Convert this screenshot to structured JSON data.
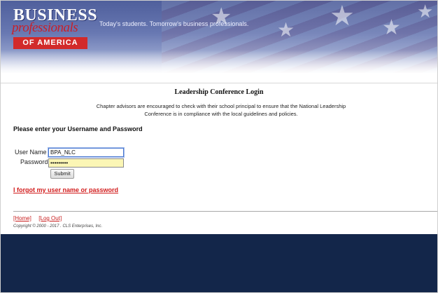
{
  "banner": {
    "logo_line1": "BUSINESS",
    "logo_line2": "professionals",
    "logo_line3": "OF AMERICA",
    "tagline": "Today's students. Tomorrow's business professionals."
  },
  "page": {
    "title": "Leadership Conference Login",
    "notice": "Chapter advisors are encouraged to check with their school principal to ensure that the National Leadership Conference is in compliance with the local guidelines and policies.",
    "prompt": "Please enter your Username and Password"
  },
  "form": {
    "username_label": "User Name",
    "username_value": "BPA_NLC",
    "password_label": "Password",
    "password_value": "•••••••••",
    "submit_label": "Submit",
    "forgot_link": "I forgot my user name or password"
  },
  "footer": {
    "home_link": "[Home]",
    "logout_link": "[Log Out]",
    "copyright": "Copyright © 2000 - 2017 . CLS Enterprises, Inc."
  },
  "colors": {
    "banner_blue": "#4f5f9c",
    "link_red": "#d21d1d",
    "bottom_navy": "#13264a",
    "password_fill": "#fbf6b5"
  },
  "icons": {
    "banner_star": "star"
  }
}
